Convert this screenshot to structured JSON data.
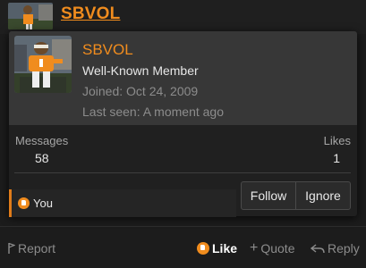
{
  "header": {
    "username": "SBVOL"
  },
  "popup": {
    "name": "SBVOL",
    "title": "Well-Known Member",
    "joined": "Joined: Oct 24, 2009",
    "last_seen": "Last seen: A moment ago",
    "stats": {
      "messages_label": "Messages",
      "messages_value": "58",
      "likes_label": "Likes",
      "likes_value": "1"
    },
    "follow_label": "Follow",
    "ignore_label": "Ignore"
  },
  "reactions": {
    "text": "You"
  },
  "actions": {
    "report_label": "Report",
    "like_label": "Like",
    "quote_label": "Quote",
    "reply_label": "Reply"
  },
  "colors": {
    "accent": "#f08c1e",
    "background": "#1c1c1c",
    "popup": "#373737"
  }
}
